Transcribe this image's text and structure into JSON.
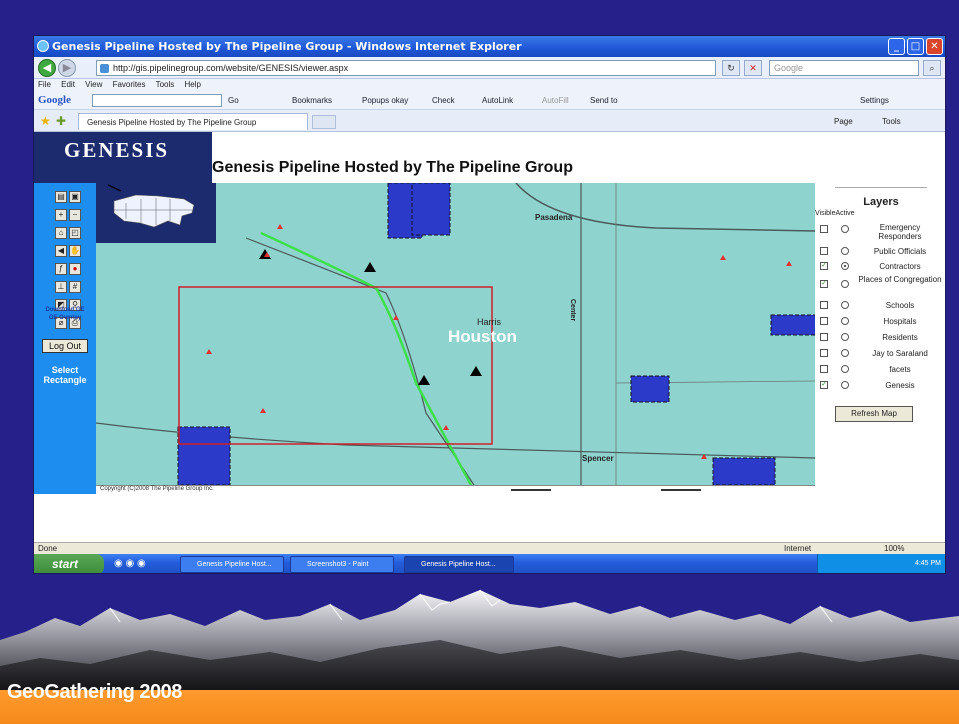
{
  "browser": {
    "window_title": "Genesis Pipeline Hosted by The Pipeline Group - Windows Internet Explorer",
    "url": "http://gis.pipelinegroup.com/website/GENESIS/viewer.aspx",
    "search_placeholder": "Google",
    "menu": [
      "File",
      "Edit",
      "View",
      "Favorites",
      "Tools",
      "Help"
    ],
    "google_toolbar": {
      "brand": "Google",
      "go": "Go",
      "bookmarks": "Bookmarks",
      "popups": "Popups okay",
      "check": "Check",
      "autolink": "AutoLink",
      "autofill": "AutoFill",
      "send_to": "Send to",
      "settings": "Settings"
    },
    "tab_title": "Genesis Pipeline Hosted by The Pipeline Group",
    "command_bar": {
      "page": "Page",
      "tools": "Tools"
    },
    "status": {
      "left": "Done",
      "zone": "Internet",
      "zoom": "100%"
    }
  },
  "app": {
    "logo_text": "GENESIS",
    "page_title": "Genesis Pipeline Hosted by The Pipeline Group",
    "tools": {
      "ge_line1": "Download GE",
      "ge_line2": "GE Overlay",
      "logout_label": "Log Out",
      "select_label_1": "Select",
      "select_label_2": "Rectangle"
    },
    "map": {
      "labels": {
        "pasadena": "Pasadena",
        "harris": "Harris",
        "houston": "Houston",
        "center": "Center",
        "spencer": "Spencer"
      },
      "copyright": "Copyright (C)2008 The Pipeline Group Inc."
    },
    "layers": {
      "title": "Layers",
      "col_visible": "Visible",
      "col_active": "Active",
      "items": [
        {
          "name": "Emergency Responders",
          "visible": false,
          "active": false
        },
        {
          "name": "Public Officials",
          "visible": false,
          "active": false
        },
        {
          "name": "Contractors",
          "visible": true,
          "active": true
        },
        {
          "name": "Places of Congregation",
          "visible": true,
          "active": false
        },
        {
          "name": "Schools",
          "visible": false,
          "active": false
        },
        {
          "name": "Hospitals",
          "visible": false,
          "active": false
        },
        {
          "name": "Residents",
          "visible": false,
          "active": false
        },
        {
          "name": "Jay to Saraland",
          "visible": false,
          "active": false
        },
        {
          "name": "facets",
          "visible": false,
          "active": false
        },
        {
          "name": "Genesis",
          "visible": true,
          "active": false
        }
      ],
      "refresh_label": "Refresh Map"
    }
  },
  "taskbar": {
    "start": "start",
    "items": [
      "Genesis Pipeline Host...",
      "Screenshot3 - Paint",
      "Genesis Pipeline Host..."
    ],
    "clock": "4:45 PM"
  },
  "slide": {
    "footer_title": "GeoGathering 2008",
    "colors": {
      "background": "#26208a",
      "footer": "#f58a1a",
      "map": "#8fd3ce"
    }
  }
}
